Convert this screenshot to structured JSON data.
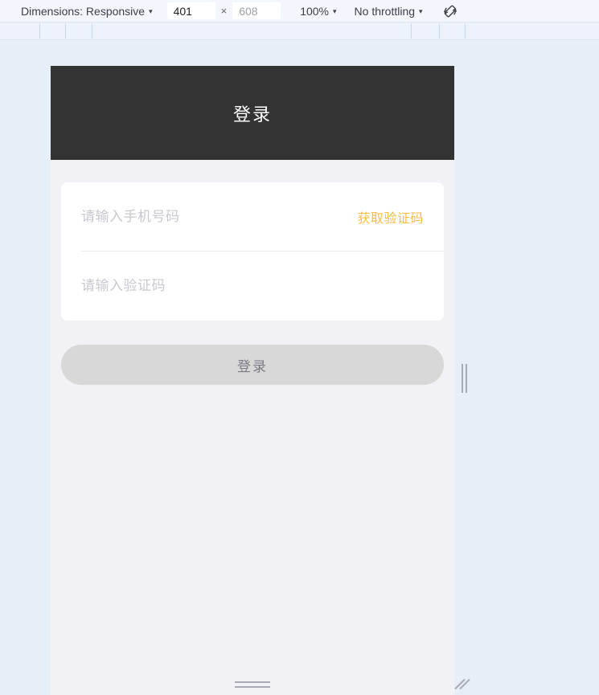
{
  "devtools": {
    "dimensions_label": "Dimensions: Responsive",
    "width_value": "401",
    "height_placeholder": "608",
    "multiply_symbol": "×",
    "zoom_label": "100%",
    "throttling_label": "No throttling",
    "rotate_icon": "rotate-device-icon",
    "caret": "▾",
    "ruler_ticks_left": [
      49,
      81,
      114
    ],
    "ruler_ticks_right": [
      511,
      546,
      578
    ],
    "toolbar_bg": "#f3f6fc",
    "ruler_bg": "#eef2fa",
    "tick_color": "#c9d8f2",
    "canvas_bg": "#e8eef8"
  },
  "page": {
    "background": "#f2f2f6",
    "header": {
      "title": "登录",
      "background": "#333333",
      "text_color": "#ffffff"
    },
    "form": {
      "card_background": "#ffffff",
      "phone_placeholder": "请输入手机号码",
      "phone_value": "",
      "get_code_label": "获取验证码",
      "get_code_color": "#fbbe44",
      "code_placeholder": "请输入验证码",
      "code_value": "",
      "placeholder_color": "#c8c9d0"
    },
    "submit": {
      "label": "登录",
      "background": "#d8d8d8",
      "text_color": "#7b7b85"
    }
  },
  "handles": {
    "right": "right-resize-handle",
    "bottom": "bottom-resize-handle",
    "corner": "corner-resize-handle"
  }
}
